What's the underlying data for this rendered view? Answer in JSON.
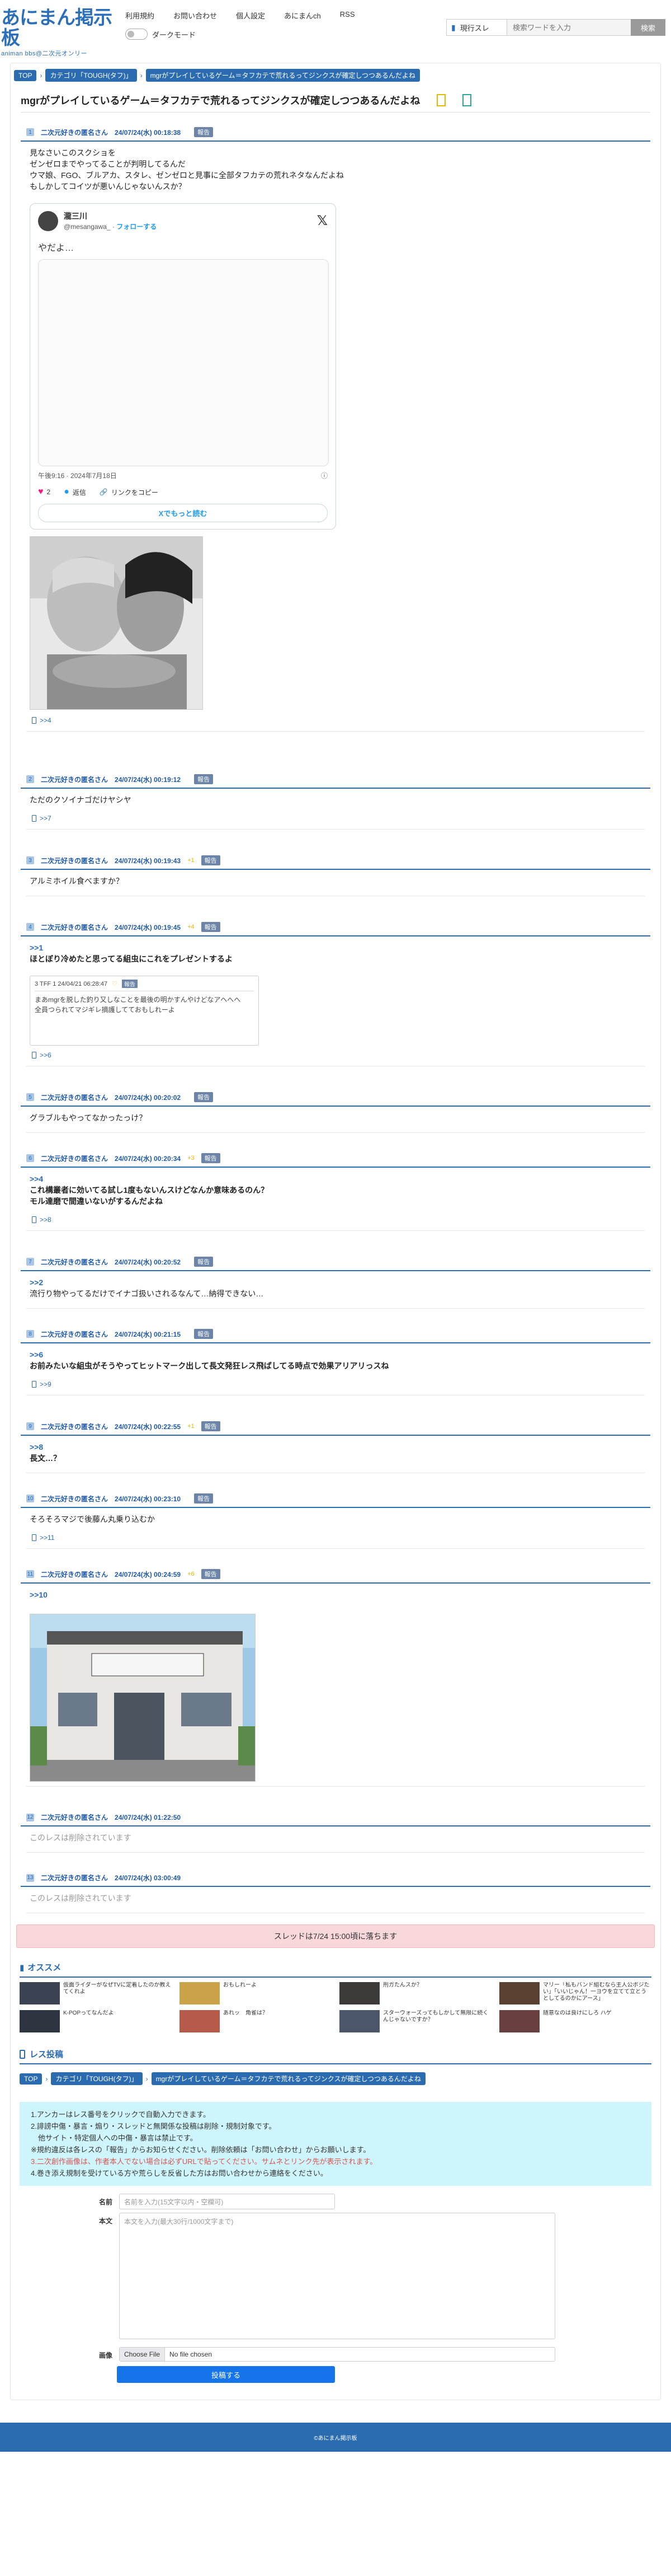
{
  "header": {
    "logo_main": "あにまん掲示板",
    "logo_sub": "animan bbs@二次元オンリー",
    "links": [
      "利用規約",
      "お問い合わせ",
      "個人設定",
      "あにまんch",
      "RSS"
    ],
    "dark_mode_label": "ダークモード",
    "search_select": "現行スレ",
    "search_placeholder": "検索ワードを入力",
    "search_button": "検索"
  },
  "breadcrumb": [
    "TOP",
    "カテゴリ「TOUGH(タフ)」",
    "mgrがプレイしているゲーム＝タフカテで荒れるってジンクスが確定しつつあるんだよね"
  ],
  "thread_title": "mgrがプレイしているゲーム＝タフカテで荒れるってジンクスが確定しつつあるんだよね",
  "posts": [
    {
      "num": "1",
      "name": "二次元好きの匿名さん",
      "date": "24/07/24(水) 00:18:38",
      "res": "",
      "report": "報告",
      "lines": [
        "見なさいこのスクショを",
        "ゼンゼロまでやってることが判明してるんだ",
        "ウマ娘、FGO、ブルアカ、スタレ、ゼンゼロと見事に全部タフカテの荒れネタなんだよね",
        "もしかしてコイツが悪いんじゃないんスか？"
      ],
      "reply": ">>4"
    },
    {
      "num": "2",
      "name": "二次元好きの匿名さん",
      "date": "24/07/24(水) 00:19:12",
      "res": "",
      "report": "報告",
      "lines": [
        "ただのクソイナゴだけヤシヤ"
      ],
      "reply": ">>7"
    },
    {
      "num": "3",
      "name": "二次元好きの匿名さん",
      "date": "24/07/24(水) 00:19:43",
      "res": "+1",
      "report": "報告",
      "lines": [
        "アルミホイル食べますか？"
      ],
      "reply": ""
    },
    {
      "num": "4",
      "name": "二次元好きの匿名さん",
      "date": "24/07/24(水) 00:19:45",
      "res": "+4",
      "report": "報告",
      "anchor": ">>1",
      "lines": [
        "ほとぼり冷めたと思ってる組虫にこれをプレゼントするよ"
      ],
      "reply": ">>6"
    },
    {
      "num": "5",
      "name": "二次元好きの匿名さん",
      "date": "24/07/24(水) 00:20:02",
      "res": "",
      "report": "報告",
      "lines": [
        "グラブルもやってなかったっけ？"
      ],
      "reply": ""
    },
    {
      "num": "6",
      "name": "二次元好きの匿名さん",
      "date": "24/07/24(水) 00:20:34",
      "res": "+3",
      "report": "報告",
      "anchor": ">>4",
      "lines": [
        "これ構叢者に効いてる試し1度もないんスけどなんか意味あるのん？",
        "モル達磨で間違いないがするんだよね"
      ],
      "reply": ">>8"
    },
    {
      "num": "7",
      "name": "二次元好きの匿名さん",
      "date": "24/07/24(水) 00:20:52",
      "res": "",
      "report": "報告",
      "anchor": ">>2",
      "lines": [
        "流行り物やってるだけでイナゴ扱いされるなんて…納得できない…"
      ],
      "reply": ""
    },
    {
      "num": "8",
      "name": "二次元好きの匿名さん",
      "date": "24/07/24(水) 00:21:15",
      "res": "",
      "report": "報告",
      "anchor": ">>6",
      "lines": [
        "お前みたいな組虫がそうやってヒットマーク出して長文発狂レス飛ばしてる時点で効果アリアリっスね"
      ],
      "reply": ">>9"
    },
    {
      "num": "9",
      "name": "二次元好きの匿名さん",
      "date": "24/07/24(水) 00:22:55",
      "res": "+1",
      "report": "報告",
      "anchor": ">>8",
      "lines": [
        "長文…？"
      ],
      "reply": ""
    },
    {
      "num": "10",
      "name": "二次元好きの匿名さん",
      "date": "24/07/24(水) 00:23:10",
      "res": "",
      "report": "報告",
      "lines": [
        "そろそろマジで後藤ん丸乗り込むか"
      ],
      "reply": ">>11"
    },
    {
      "num": "11",
      "name": "二次元好きの匿名さん",
      "date": "24/07/24(水) 00:24:59",
      "res": "+6",
      "report": "報告",
      "anchor": ">>10",
      "lines": [],
      "reply": ""
    },
    {
      "num": "12",
      "name": "二次元好きの匿名さん",
      "date": "24/07/24(水) 01:22:50",
      "res": "",
      "report": "",
      "lines": [],
      "deleted": "このレスは削除されています",
      "reply": ""
    },
    {
      "num": "13",
      "name": "二次元好きの匿名さん",
      "date": "24/07/24(水) 03:00:49",
      "res": "",
      "report": "",
      "lines": [],
      "deleted": "このレスは削除されています",
      "reply": ""
    }
  ],
  "tweet": {
    "name": "瀧三川",
    "handle": "@mesangawa_",
    "follow": "フォローする",
    "text": "やだよ…",
    "timestamp": "午後9:16 · 2024年7月18日",
    "likes": "2",
    "reply_label": "返信",
    "copy_label": "リンクをコピー",
    "more_label": "Xでもっと読む"
  },
  "quote": {
    "head": "3 TFF 1 24/04/21 06:28:47",
    "tag": "報告",
    "lines": [
      "まあmgrを脱した釣り又しなことを最後の明かすんやけどなアヘへへ",
      "全員つられてマジギレ摘護してておもしれーよ"
    ]
  },
  "notice": "スレッドは7/24 15:00頃に落ちます",
  "osusume": {
    "title": "オススメ",
    "items": [
      {
        "text": "仮面ライダーがなぜTVに定着したのか教えてくれよ",
        "color": "#3b4252"
      },
      {
        "text": "おもしれーよ",
        "color": "#c9a24a"
      },
      {
        "text": "刑ガたんスか？",
        "color": "#3f3a3a"
      },
      {
        "text": "マリー「私もバンド組むなら主人公ポジたい」「いいじゃん！一ヨウを立てて立とうとしてるのかにアース」",
        "color": "#5a4030"
      },
      {
        "text": "K-POPってなんだよ",
        "color": "#2e3440"
      },
      {
        "text": "あれッ　角雀は？",
        "color": "#b65a4a"
      },
      {
        "text": "スターウォーズってもしかして無限に続くんじゃないですか？",
        "color": "#4c566a"
      },
      {
        "text": "随意なのは良けにしろ ハゲ",
        "color": "#6a3f3f"
      }
    ]
  },
  "form": {
    "title": "レス投稿",
    "rules": [
      "1.アンカーはレス番号をクリックで自動入力できます。",
      "2.誹謗中傷・暴言・煽り・スレッドと無関係な投稿は削除・規制対象です。",
      "　他サイト・特定個人への中傷・暴言は禁止です。",
      "※規約違反は各レスの「報告」からお知らせください。削除依頼は「お問い合わせ」からお願いします。",
      "3.二次創作画像は、作者本人でない場合は必ずURLで貼ってください。サムネとリンク先が表示されます。",
      "4.巻き添え規制を受けている方や荒らしを反省した方はお問い合わせから連絡をください。"
    ],
    "name_label": "名前",
    "name_placeholder": "名前を入力(15文字以内・空欄可)",
    "body_label": "本文",
    "body_placeholder": "本文を入力(最大30行/1000文字まで)",
    "image_label": "画像",
    "file_button": "Choose File",
    "file_name": "No file chosen",
    "submit": "投稿する"
  },
  "footer": "©あにまん掲示板"
}
